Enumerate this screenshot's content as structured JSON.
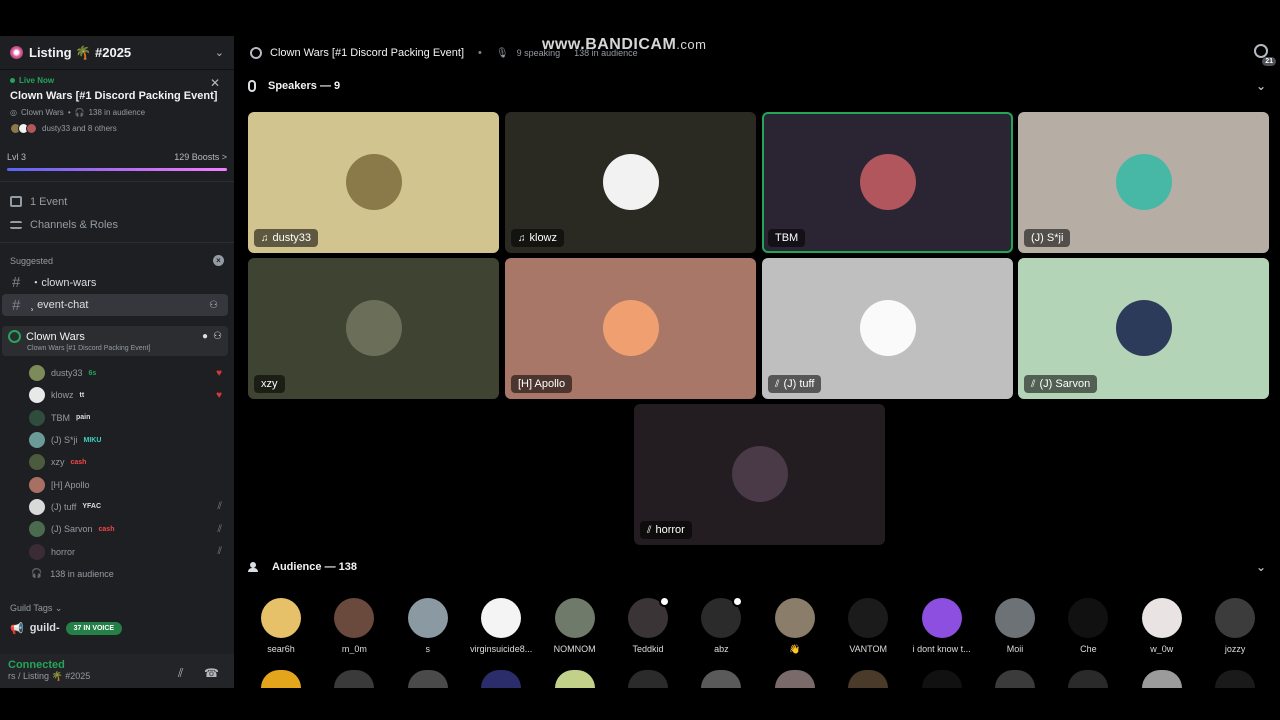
{
  "watermark": {
    "text": "www.BANDICAM",
    "suffix": ".com"
  },
  "sidebar": {
    "server_title": "Listing 🌴 #2025",
    "live": {
      "badge": "Live Now",
      "title": "Clown Wars [#1 Discord Packing Event]",
      "meta_channel": "Clown Wars",
      "meta_audience": "138 in audience",
      "participants": "dusty33 and 8 others"
    },
    "boost": {
      "level": "Lvl 3",
      "boosts": "129 Boosts",
      "chevron": ">"
    },
    "links": [
      {
        "label": "1 Event",
        "icon": "calendar-icon"
      },
      {
        "label": "Channels & Roles",
        "icon": "list-icon"
      }
    ],
    "suggested_label": "Suggested",
    "channels": [
      {
        "label": "・clown-wars"
      },
      {
        "label": "¸ event-chat"
      }
    ],
    "voice_channel": {
      "name": "Clown Wars",
      "subtitle": "Clown Wars [#1 Discord Packing Event]"
    },
    "members": [
      {
        "name": "dusty33",
        "tag": "6s",
        "tag_color": "#23a55a",
        "avatar": "#7d8b5a",
        "right": "stream"
      },
      {
        "name": "klowz",
        "tag": "tt",
        "tag_color": "#dbdee1",
        "avatar": "#e8e8e8",
        "right": "stream"
      },
      {
        "name": "TBM",
        "tag": "pain",
        "tag_color": "#dbdee1",
        "avatar": "#2f4c3c",
        "right": ""
      },
      {
        "name": "(J) S*ji",
        "tag": "MIKU",
        "tag_color": "#3fd1c0",
        "avatar": "#6a9b98",
        "right": ""
      },
      {
        "name": "xzy",
        "tag": "cash",
        "tag_color": "#f04747",
        "avatar": "#4c5a3e",
        "right": ""
      },
      {
        "name": "[H] Apollo",
        "tag": "",
        "tag_color": "#dbdee1",
        "avatar": "#a87062",
        "right": ""
      },
      {
        "name": "(J) tuff",
        "tag": "YFAC",
        "tag_color": "#dbdee1",
        "avatar": "#d9d9d9",
        "right": "muted"
      },
      {
        "name": "(J) Sarvon",
        "tag": "cash",
        "tag_color": "#f04747",
        "avatar": "#4b6b4f",
        "right": "muted"
      },
      {
        "name": "horror",
        "tag": "",
        "tag_color": "#dbdee1",
        "avatar": "#3a2c32",
        "right": "muted"
      }
    ],
    "audience_count": "138 in audience",
    "guild_tags_label": "Guild Tags",
    "guild_name": "guild-",
    "voice_pill": "37 IN VOICE",
    "connection": {
      "status": "Connected",
      "location": "rs / Listing 🌴 #2025"
    }
  },
  "stage": {
    "title": "Clown Wars [#1 Discord Packing Event]",
    "speaking": "9 speaking",
    "audience": "138 in audience",
    "notif_count": "21",
    "speakers_label": "Speakers — 9",
    "audience_label": "Audience — 138"
  },
  "speakers": [
    {
      "name": "dusty33",
      "bg": "#d2c48e",
      "avatar": "#8a7a4a",
      "icon": "stream",
      "speaking": false
    },
    {
      "name": "klowz",
      "bg": "#2b2a22",
      "avatar": "#f2f2f2",
      "icon": "stream",
      "speaking": false
    },
    {
      "name": "TBM",
      "bg": "#2a2433",
      "avatar": "#b0565c",
      "icon": "",
      "speaking": true
    },
    {
      "name": "(J) S*ji",
      "bg": "#b6aea4",
      "avatar": "#47b7a6",
      "icon": "",
      "speaking": false
    },
    {
      "name": "xzy",
      "bg": "#3f4332",
      "avatar": "#6b6f5a",
      "icon": "",
      "speaking": false
    },
    {
      "name": "[H] Apollo",
      "bg": "#a97767",
      "avatar": "#f0a070",
      "icon": "",
      "speaking": false
    },
    {
      "name": "(J) tuff",
      "bg": "#bfbfbf",
      "avatar": "#fafafa",
      "icon": "muted",
      "speaking": false
    },
    {
      "name": "(J) Sarvon",
      "bg": "#b3d4b6",
      "avatar": "#2c3b5a",
      "icon": "muted",
      "speaking": false
    },
    {
      "name": "horror",
      "bg": "#231c20",
      "avatar": "#4a3a48",
      "icon": "muted",
      "speaking": false
    }
  ],
  "audience": [
    {
      "name": "sear6h",
      "avatar": "#e7c16a",
      "ring": false
    },
    {
      "name": "m_0m",
      "avatar": "#6b4a3e",
      "ring": false
    },
    {
      "name": "s",
      "avatar": "#8b9aa2",
      "ring": false
    },
    {
      "name": "virginsuicide8...",
      "avatar": "#f4f4f4",
      "ring": false
    },
    {
      "name": "NOMNOM",
      "avatar": "#6f7a6a",
      "ring": false
    },
    {
      "name": "Teddkid",
      "avatar": "#3b3437",
      "ring": true
    },
    {
      "name": "abz",
      "avatar": "#2b2b2b",
      "ring": true
    },
    {
      "name": "👋",
      "avatar": "#8a7d6a",
      "ring": false
    },
    {
      "name": "VANTOM",
      "avatar": "#1b1b1b",
      "ring": false
    },
    {
      "name": "i dont know t...",
      "avatar": "#8d4fe0",
      "ring": false
    },
    {
      "name": "Moii",
      "avatar": "#6d7277",
      "ring": false
    },
    {
      "name": "Che",
      "avatar": "#111111",
      "ring": false
    },
    {
      "name": "w_0w",
      "avatar": "#e9e3e3",
      "ring": false
    },
    {
      "name": "jozzy",
      "avatar": "#3c3c3c",
      "ring": false
    }
  ],
  "audience_row2": [
    "#e2a51c",
    "#3a3a3a",
    "#4a4a4a",
    "#2a2d6a",
    "#c2d18a",
    "#2b2b2b",
    "#5a5a5a",
    "#7a6a6a",
    "#4a3a2a",
    "#111111",
    "#3b3b3b",
    "#2a2a2a",
    "#9b9b9b",
    "#1a1a1a"
  ]
}
